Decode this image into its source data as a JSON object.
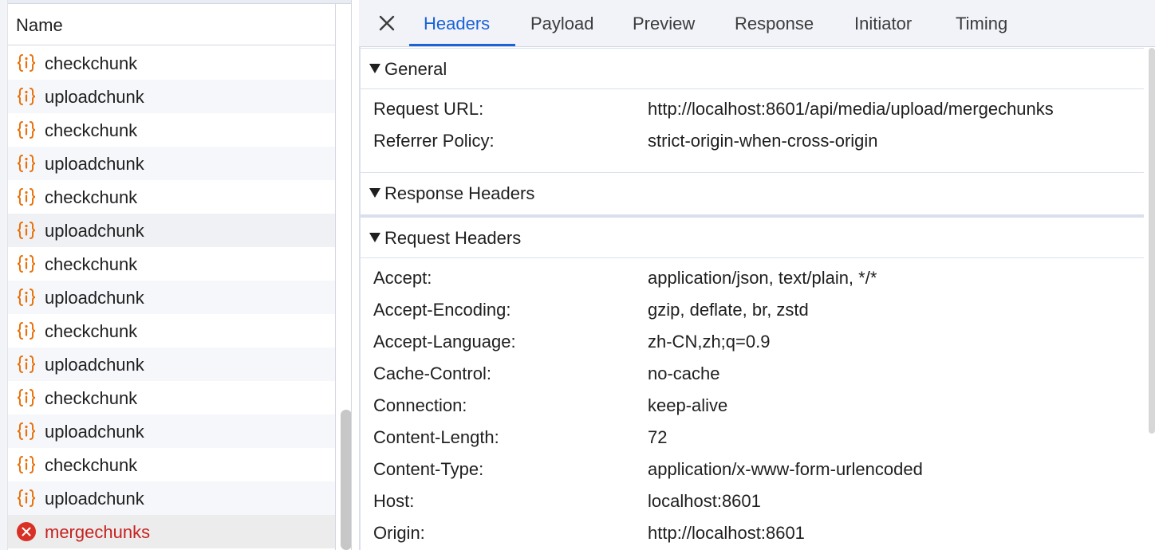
{
  "list": {
    "column_header": "Name",
    "items": [
      {
        "label": "checkchunk",
        "type": "fetch"
      },
      {
        "label": "uploadchunk",
        "type": "fetch"
      },
      {
        "label": "checkchunk",
        "type": "fetch"
      },
      {
        "label": "uploadchunk",
        "type": "fetch"
      },
      {
        "label": "checkchunk",
        "type": "fetch"
      },
      {
        "label": "uploadchunk",
        "type": "fetch"
      },
      {
        "label": "checkchunk",
        "type": "fetch"
      },
      {
        "label": "uploadchunk",
        "type": "fetch"
      },
      {
        "label": "checkchunk",
        "type": "fetch"
      },
      {
        "label": "uploadchunk",
        "type": "fetch"
      },
      {
        "label": "checkchunk",
        "type": "fetch"
      },
      {
        "label": "uploadchunk",
        "type": "fetch"
      },
      {
        "label": "checkchunk",
        "type": "fetch"
      },
      {
        "label": "uploadchunk",
        "type": "fetch"
      },
      {
        "label": "mergechunks",
        "type": "error"
      }
    ]
  },
  "tabs": {
    "items": [
      "Headers",
      "Payload",
      "Preview",
      "Response",
      "Initiator",
      "Timing"
    ],
    "active": "Headers"
  },
  "sections": {
    "general": {
      "title": "General",
      "rows": [
        {
          "key": "Request URL:",
          "value": "http://localhost:8601/api/media/upload/mergechunks"
        },
        {
          "key": "Referrer Policy:",
          "value": "strict-origin-when-cross-origin"
        }
      ]
    },
    "response_headers": {
      "title": "Response Headers"
    },
    "request_headers": {
      "title": "Request Headers",
      "rows": [
        {
          "key": "Accept:",
          "value": "application/json, text/plain, */*"
        },
        {
          "key": "Accept-Encoding:",
          "value": "gzip, deflate, br, zstd"
        },
        {
          "key": "Accept-Language:",
          "value": "zh-CN,zh;q=0.9"
        },
        {
          "key": "Cache-Control:",
          "value": "no-cache"
        },
        {
          "key": "Connection:",
          "value": "keep-alive"
        },
        {
          "key": "Content-Length:",
          "value": "72"
        },
        {
          "key": "Content-Type:",
          "value": "application/x-www-form-urlencoded"
        },
        {
          "key": "Host:",
          "value": "localhost:8601"
        },
        {
          "key": "Origin:",
          "value": "http://localhost:8601"
        }
      ]
    }
  },
  "icons": {
    "fetch": "fetch-braces-icon",
    "error": "error-circle-icon",
    "close": "close-icon",
    "expand": "triangle-down-icon"
  },
  "colors": {
    "accent": "#1a62d6",
    "fetch_icon": "#e8710a",
    "error": "#d93025",
    "error_text": "#c5221f"
  }
}
